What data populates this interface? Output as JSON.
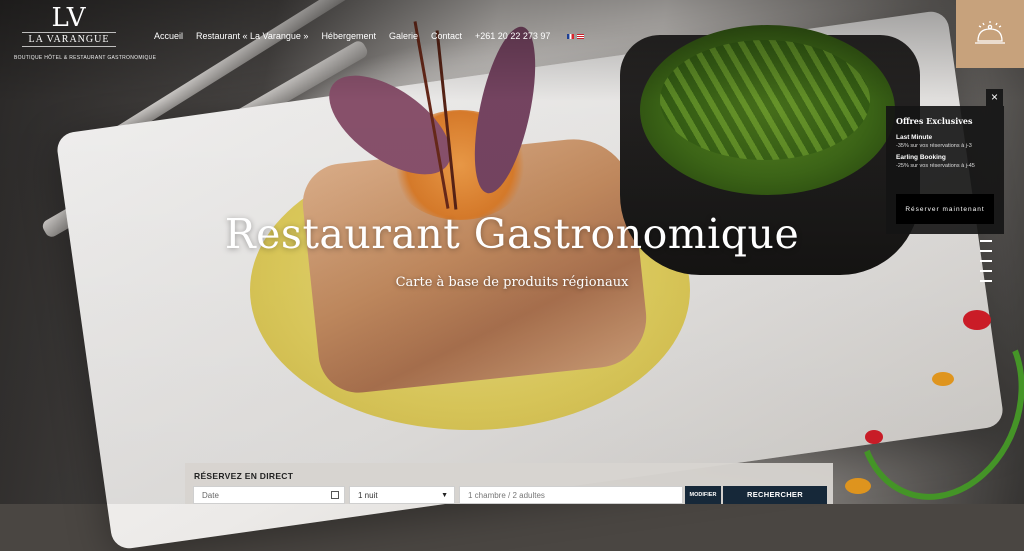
{
  "logo": {
    "mark": "LV",
    "name": "LA VARANGUE",
    "tagline": "BOUTIQUE HÔTEL & RESTAURANT GASTRONOMIQUE"
  },
  "nav": {
    "items": [
      "Accueil",
      "Restaurant « La Varangue »",
      "Hébergement",
      "Galerie",
      "Contact",
      "+261 20 22 273 97"
    ]
  },
  "hero": {
    "title": "Restaurant Gastronomique",
    "subtitle": "Carte à base de produits régionaux"
  },
  "offers": {
    "title": "Offres Exclusives",
    "items": [
      {
        "name": "Last Minute",
        "desc": "-35% sur vos réservations à j-3"
      },
      {
        "name": "Earling Booking",
        "desc": "-25% sur vos réservations à j-45"
      }
    ],
    "button": "Réserver maintenant",
    "close": "×"
  },
  "booking": {
    "title": "RÉSERVEZ EN DIRECT",
    "date_placeholder": "Date",
    "nights": "1 nuit",
    "rooms": "1 chambre / 2 adultes",
    "modify": "MODIFIER",
    "search": "RECHERCHER"
  },
  "colors": {
    "accent": "#c7a27c",
    "button_dark": "#162839",
    "panel": "#141414"
  }
}
